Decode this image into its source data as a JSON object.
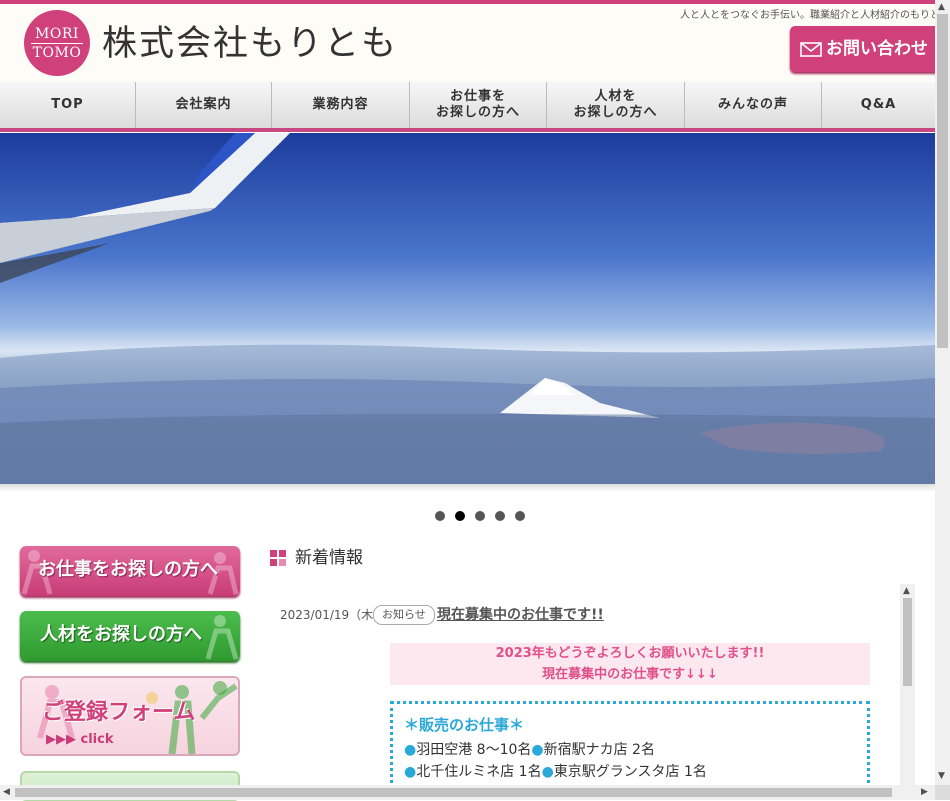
{
  "header": {
    "logo_line1": "MORI",
    "logo_line2": "TOMO",
    "company_name": "株式会社もりとも",
    "tagline": "人と人とをつなぐお手伝い。職業紹介と人材紹介のもりとも",
    "contact_label": "お問い合わせ"
  },
  "nav": {
    "items": [
      {
        "line1": "TOP",
        "line2": ""
      },
      {
        "line1": "会社案内",
        "line2": ""
      },
      {
        "line1": "業務内容",
        "line2": ""
      },
      {
        "line1": "お仕事を",
        "line2": "お探しの方へ"
      },
      {
        "line1": "人材を",
        "line2": "お探しの方へ"
      },
      {
        "line1": "みんなの声",
        "line2": ""
      },
      {
        "line1": "Q&A",
        "line2": ""
      }
    ]
  },
  "slider": {
    "active_index": 1,
    "count": 5
  },
  "sidebar": {
    "job_seeker": "お仕事をお探しの方へ",
    "employer": "人材をお探しの方へ",
    "register": "ご登録フォーム",
    "register_click": "▶▶▶ click"
  },
  "news": {
    "heading": "新着情報",
    "date": "2023/01/19（木)",
    "category": "お知らせ",
    "title": "現在募集中のお仕事です!!",
    "greeting1": "2023年もどうぞよろしくお願いいたします!!",
    "greeting2": "現在募集中のお仕事です↓↓↓",
    "section_title": "＊販売のお仕事＊",
    "jobs": [
      {
        "place": "羽田空港 8〜10名"
      },
      {
        "place": "新宿駅ナカ店 2名"
      },
      {
        "place": "北千住ルミネ店 1名"
      },
      {
        "place": "東京駅グランスタ店 1名"
      }
    ]
  },
  "colors": {
    "brand_pink": "#d0407a",
    "green": "#3aa83a",
    "accent_blue": "#2aa8d8",
    "news_pink_bg": "#fde8f0"
  }
}
